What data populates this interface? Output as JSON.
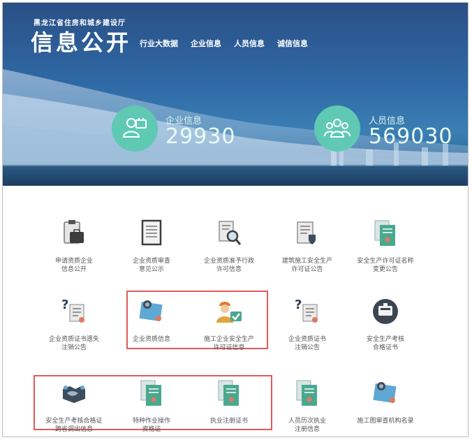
{
  "header": {
    "org_name": "黑龙江省住房和城乡建设厅",
    "logo_text": "信息公开",
    "nav": [
      "行业大数据",
      "企业信息",
      "人员信息",
      "诚信信息"
    ]
  },
  "stats": {
    "company": {
      "label": "企业信息",
      "value": "29930"
    },
    "people": {
      "label": "人员信息",
      "value": "569030"
    }
  },
  "colors": {
    "accent_teal": "#5fc9b4",
    "highlight_red": "#e05a57",
    "banner_blue": "#2f6aa6"
  },
  "grid": {
    "row1": [
      {
        "label": "申请资质企业\n信息公开",
        "icon": "clipboard-briefcase-icon"
      },
      {
        "label": "企业资质审查\n意见公示",
        "icon": "document-list-icon"
      },
      {
        "label": "企业资质准予行政\n许可信息",
        "icon": "document-search-icon"
      },
      {
        "label": "建筑施工安全生产\n许可证公告",
        "icon": "document-shield-icon"
      },
      {
        "label": "安全生产许可证名称\n变更公告",
        "icon": "certificate-icon"
      }
    ],
    "row2": [
      {
        "label": "企业资质证书遗失\n注销公告",
        "icon": "question-document-icon"
      },
      {
        "label": "企业资质信息",
        "icon": "badge-card-icon"
      },
      {
        "label": "施工企业安全生产\n许可证信息",
        "icon": "worker-check-icon"
      },
      {
        "label": "企业资质证书\n注销公告",
        "icon": "question-document-icon"
      },
      {
        "label": "安全生产考核\n合格证书",
        "icon": "id-card-icon"
      }
    ],
    "row3": [
      {
        "label": "安全生产考核合格证\n跨省调出信息",
        "icon": "handshake-icon"
      },
      {
        "label": "特种作业操作\n资格证",
        "icon": "certificate-icon"
      },
      {
        "label": "执业注册证书",
        "icon": "certificate-icon"
      },
      {
        "label": "人员历次执业\n注册信息",
        "icon": "certificate-icon"
      },
      {
        "label": "施工图审查机构名录",
        "icon": "badge-card-icon"
      }
    ]
  }
}
